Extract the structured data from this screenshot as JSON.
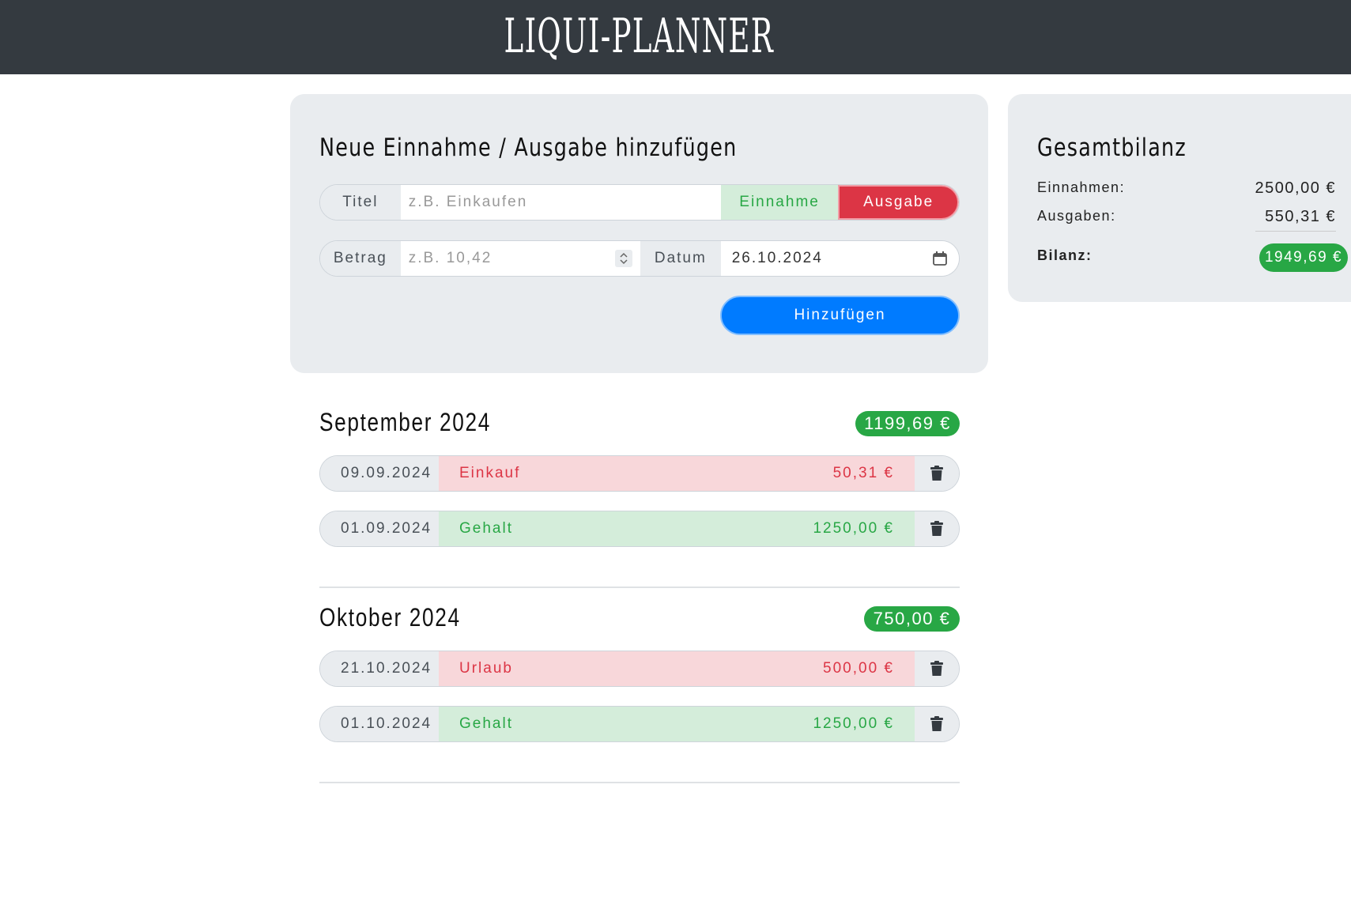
{
  "app": {
    "title": "LIQUI-PLANNER"
  },
  "form": {
    "heading": "Neue Einnahme / Ausgabe hinzufügen",
    "title_label": "Titel",
    "title_placeholder": "z.B. Einkaufen",
    "type_income": "Einnahme",
    "type_expense": "Ausgabe",
    "selected_type": "Ausgabe",
    "amount_label": "Betrag",
    "amount_placeholder": "z.B. 10,42",
    "date_label": "Datum",
    "date_value": "26.10.2024",
    "submit_label": "Hinzufügen"
  },
  "summary": {
    "heading": "Gesamtbilanz",
    "income_label": "Einnahmen:",
    "income_value": "2500,00 €",
    "expense_label": "Ausgaben:",
    "expense_value": "550,31 €",
    "balance_label": "Bilanz:",
    "balance_value": "1949,69 €"
  },
  "months": [
    {
      "title": "September 2024",
      "balance": "1199,69 €",
      "entries": [
        {
          "date": "09.09.2024",
          "title": "Einkauf",
          "amount": "50,31 €",
          "type": "expense"
        },
        {
          "date": "01.09.2024",
          "title": "Gehalt",
          "amount": "1250,00 €",
          "type": "income"
        }
      ]
    },
    {
      "title": "Oktober 2024",
      "balance": "750,00 €",
      "entries": [
        {
          "date": "21.10.2024",
          "title": "Urlaub",
          "amount": "500,00 €",
          "type": "expense"
        },
        {
          "date": "01.10.2024",
          "title": "Gehalt",
          "amount": "1250,00 €",
          "type": "income"
        }
      ]
    }
  ],
  "colors": {
    "header_bg": "#343a40",
    "income": "#28a745",
    "expense": "#dc3545",
    "primary": "#007bff"
  }
}
